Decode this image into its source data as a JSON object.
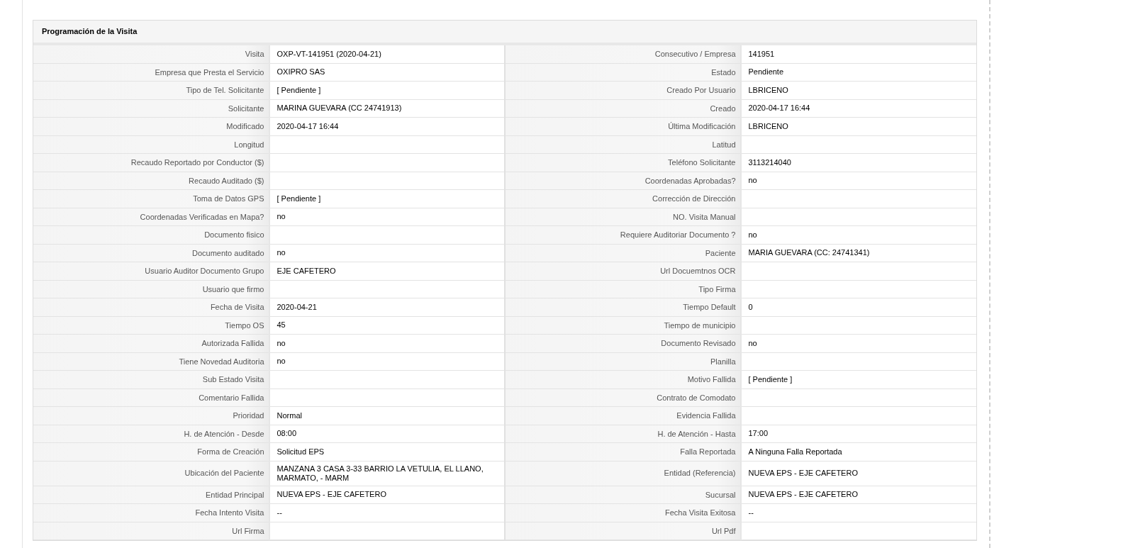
{
  "panel": {
    "title": "Programación de la Visita",
    "rows": [
      {
        "left": {
          "label": "Visita",
          "value": "OXP-VT-141951 (2020-04-21)"
        },
        "right": {
          "label": "Consecutivo / Empresa",
          "value": "141951"
        }
      },
      {
        "left": {
          "label": "Empresa que Presta el Servicio",
          "value": "OXIPRO SAS"
        },
        "right": {
          "label": "Estado",
          "value": "Pendiente"
        }
      },
      {
        "left": {
          "label": "Tipo de Tel. Solicitante",
          "value": "[ Pendiente ]"
        },
        "right": {
          "label": "Creado Por Usuario",
          "value": "LBRICENO"
        }
      },
      {
        "left": {
          "label": "Solicitante",
          "value": "MARINA GUEVARA (CC 24741913)"
        },
        "right": {
          "label": "Creado",
          "value": "2020-04-17 16:44"
        }
      },
      {
        "left": {
          "label": "Modificado",
          "value": "2020-04-17 16:44"
        },
        "right": {
          "label": "Última Modificación",
          "value": "LBRICENO"
        }
      },
      {
        "left": {
          "label": "Longitud"
        },
        "right": {
          "label": "Latitud"
        }
      },
      {
        "left": {
          "label": "Recaudo Reportado por Conductor ($)"
        },
        "right": {
          "label": "Teléfono Solicitante",
          "value": "3113214040"
        }
      },
      {
        "left": {
          "label": "Recaudo Auditado ($)"
        },
        "right": {
          "label": "Coordenadas Aprobadas?",
          "value": "no"
        }
      },
      {
        "left": {
          "label": "Toma de Datos GPS",
          "value": "[ Pendiente ]"
        },
        "right": {
          "label": "Corrección de Dirección"
        }
      },
      {
        "left": {
          "label": "Coordenadas Verificadas en Mapa?",
          "value": "no"
        },
        "right": {
          "label": "NO. Visita Manual"
        }
      },
      {
        "left": {
          "label": "Documento fisico"
        },
        "right": {
          "label": "Requiere Auditoriar Documento ?",
          "value": "no"
        }
      },
      {
        "left": {
          "label": "Documento auditado",
          "value": "no"
        },
        "right": {
          "label": "Paciente",
          "value": "MARIA GUEVARA (CC: 24741341)"
        }
      },
      {
        "left": {
          "label": "Usuario Auditor Documento Grupo",
          "value": "EJE CAFETERO"
        },
        "right": {
          "label": "Url Docuemtnos OCR"
        }
      },
      {
        "left": {
          "label": "Usuario que firmo"
        },
        "right": {
          "label": "Tipo Firma"
        }
      },
      {
        "left": {
          "label": "Fecha de Visita",
          "value": "2020-04-21"
        },
        "right": {
          "label": "Tiempo Default",
          "value": "0"
        }
      },
      {
        "left": {
          "label": "Tiempo OS",
          "value": "45"
        },
        "right": {
          "label": "Tiempo de municipio"
        }
      },
      {
        "left": {
          "label": "Autorizada Fallida",
          "value": "no"
        },
        "right": {
          "label": "Documento Revisado",
          "value": "no"
        }
      },
      {
        "left": {
          "label": "Tiene Novedad Auditoria",
          "value": "no"
        },
        "right": {
          "label": "Planilla"
        }
      },
      {
        "left": {
          "label": "Sub Estado Visita"
        },
        "right": {
          "label": "Motivo Fallida",
          "value": "[ Pendiente ]"
        }
      },
      {
        "left": {
          "label": "Comentario Fallida"
        },
        "right": {
          "label": "Contrato de Comodato"
        }
      },
      {
        "left": {
          "label": "Prioridad",
          "value": "Normal"
        },
        "right": {
          "label": "Evidencia Fallida"
        }
      },
      {
        "left": {
          "label": "H. de Atención - Desde",
          "value": "08:00"
        },
        "right": {
          "label": "H. de Atención - Hasta",
          "value": "17:00"
        }
      },
      {
        "left": {
          "label": "Forma de Creación",
          "value": "Solicitud EPS"
        },
        "right": {
          "label": "Falla Reportada",
          "value": "A Ninguna Falla Reportada"
        }
      },
      {
        "left": {
          "label": "Ubicación del Paciente",
          "value": "MANZANA 3 CASA 3-33 BARRIO LA VETULIA, EL LLANO, MARMATO, - MARM"
        },
        "right": {
          "label": "Entidad (Referencia)",
          "value": "NUEVA EPS - EJE CAFETERO"
        }
      },
      {
        "left": {
          "label": "Entidad Principal",
          "value": "NUEVA EPS - EJE CAFETERO"
        },
        "right": {
          "label": "Sucursal",
          "value": "NUEVA EPS - EJE CAFETERO"
        }
      },
      {
        "left": {
          "label": "Fecha Intento Visita",
          "value": "--"
        },
        "right": {
          "label": "Fecha Visita Exitosa",
          "value": "--"
        }
      },
      {
        "left": {
          "label": "Url Firma"
        },
        "right": {
          "label": "Url Pdf"
        }
      }
    ]
  }
}
